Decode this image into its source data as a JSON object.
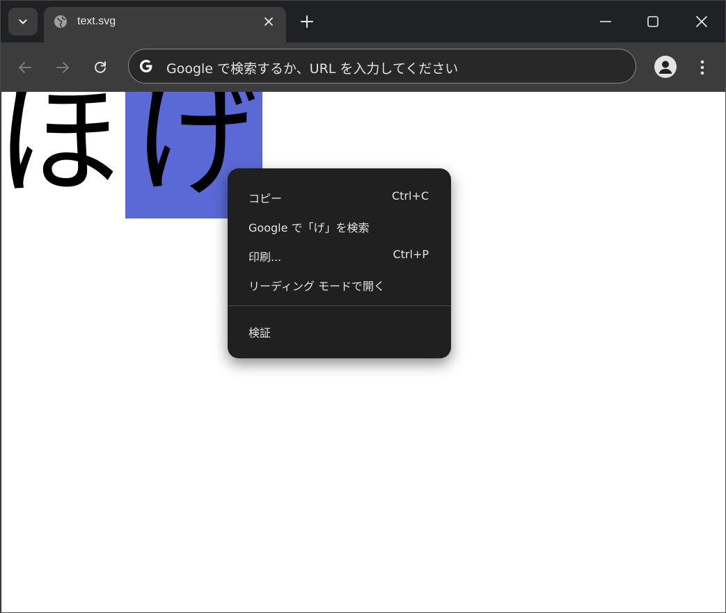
{
  "tab": {
    "title": "text.svg",
    "favicon": "globe-icon"
  },
  "toolbar": {
    "omnibox_placeholder": "Google で検索するか、URL を入力してください"
  },
  "page": {
    "char_1": "ほ",
    "char_2": "げ",
    "selection_color": "#5a69d6"
  },
  "context_menu": {
    "items": [
      {
        "label": "コピー",
        "shortcut": "Ctrl+C"
      },
      {
        "label": "Google で「げ」を検索",
        "shortcut": ""
      },
      {
        "label": "印刷...",
        "shortcut": "Ctrl+P"
      },
      {
        "label": "リーディング モードで開く",
        "shortcut": ""
      },
      {
        "label": "検証",
        "shortcut": ""
      }
    ]
  },
  "colors": {
    "tab_strip": "#202124",
    "toolbar": "#3c3c3c",
    "menu_bg": "#202020",
    "menu_text": "#e3e3e3"
  }
}
